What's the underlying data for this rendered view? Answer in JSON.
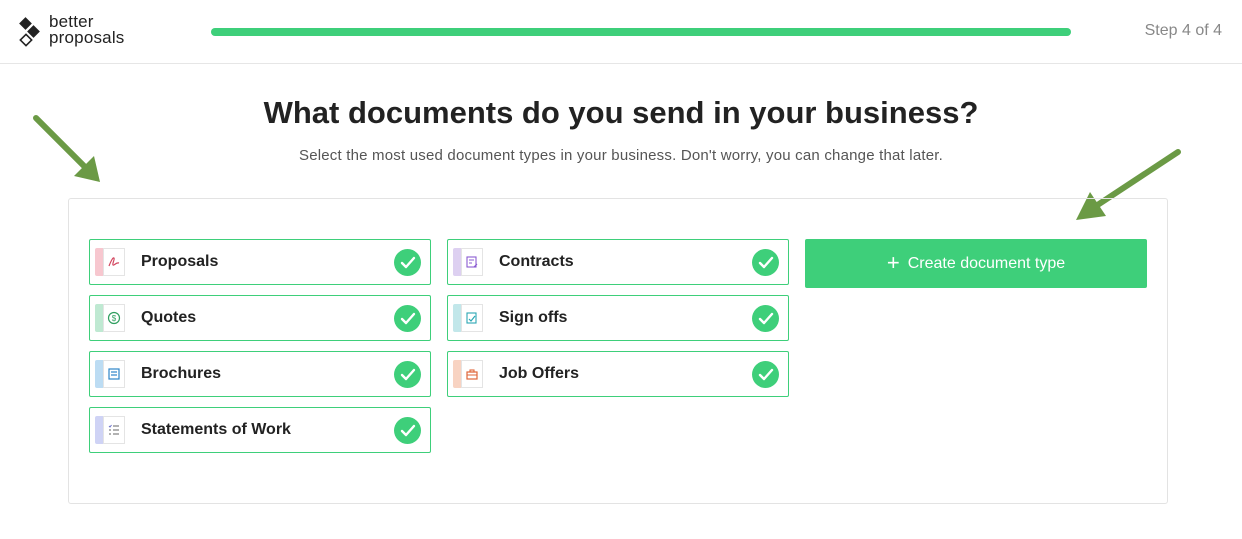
{
  "brand": {
    "line1": "better",
    "line2": "proposals"
  },
  "progress": {
    "percent": 100,
    "step_label": "Step 4 of 4"
  },
  "page": {
    "title": "What documents do you send in your business?",
    "subtitle": "Select the most used document types in your business. Don't worry, you can change that later."
  },
  "documents": [
    {
      "label": "Proposals",
      "icon": "pen-signature-icon",
      "accent": "#f7c7cf",
      "checked": true
    },
    {
      "label": "Quotes",
      "icon": "dollar-coin-icon",
      "accent": "#bfe9d2",
      "checked": true
    },
    {
      "label": "Brochures",
      "icon": "brochure-icon",
      "accent": "#bcdcf3",
      "checked": true
    },
    {
      "label": "Statements of Work",
      "icon": "checklist-icon",
      "accent": "#cfd3f5",
      "checked": true
    },
    {
      "label": "Contracts",
      "icon": "contract-edit-icon",
      "accent": "#ddd0f1",
      "checked": true
    },
    {
      "label": "Sign offs",
      "icon": "sign-off-icon",
      "accent": "#c2e7ea",
      "checked": true
    },
    {
      "label": "Job Offers",
      "icon": "briefcase-icon",
      "accent": "#f8d3c2",
      "checked": true
    }
  ],
  "actions": {
    "create_label": "Create document type"
  },
  "colors": {
    "accent_green": "#3ecf7a",
    "annotation_arrow": "#6b9a45"
  }
}
